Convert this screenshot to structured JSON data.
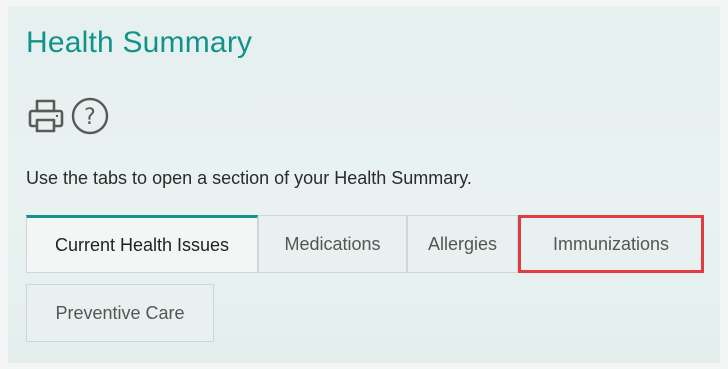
{
  "header": {
    "title": "Health Summary"
  },
  "toolbar": {
    "print_icon": "printer-icon",
    "help_icon": "question-circle-icon"
  },
  "instructions": "Use the tabs to open a section of your Health Summary.",
  "tabs": [
    {
      "label": "Current Health Issues",
      "active": true
    },
    {
      "label": "Medications",
      "active": false
    },
    {
      "label": "Allergies",
      "active": false
    },
    {
      "label": "Immunizations",
      "active": false,
      "highlighted": true
    },
    {
      "label": "Preventive Care",
      "active": false
    }
  ],
  "colors": {
    "accent": "#12938a",
    "highlight": "#e03c41"
  }
}
